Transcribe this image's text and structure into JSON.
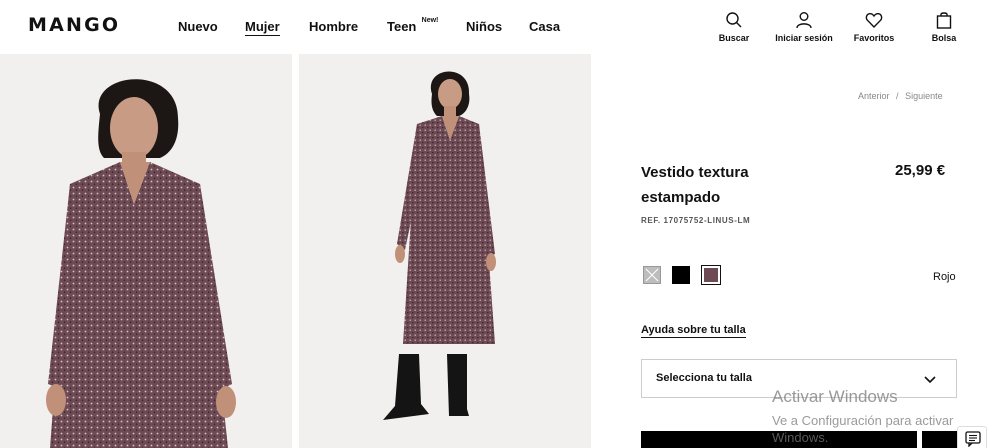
{
  "brand": {
    "logo": "MANGO"
  },
  "nav": {
    "items": [
      {
        "label": "Nuevo"
      },
      {
        "label": "Mujer",
        "active": true
      },
      {
        "label": "Hombre"
      },
      {
        "label": "Teen",
        "badge": "New!"
      },
      {
        "label": "Niños"
      },
      {
        "label": "Casa"
      }
    ]
  },
  "header_actions": {
    "search": "Buscar",
    "login": "Iniciar sesión",
    "favorites": "Favoritos",
    "bag": "Bolsa"
  },
  "pagination": {
    "previous": "Anterior",
    "separator": "/",
    "next": "Siguiente"
  },
  "product": {
    "title": "Vestido textura estampado",
    "price": "25,99 €",
    "reference": "REF. 17075752-LINUS-LM",
    "colors": [
      {
        "name": "gray-unavailable",
        "hex": "#bdbdbd"
      },
      {
        "name": "black",
        "hex": "#000000"
      },
      {
        "name": "red-selected",
        "hex": "#6e4b54",
        "selected": true
      }
    ],
    "selected_color": "Rojo",
    "size_help": "Ayuda sobre tu talla",
    "size_select_placeholder": "Selecciona tu talla"
  },
  "overlay": {
    "windows_title": "Activar Windows",
    "windows_subtitle_1": "Ve a Configuración para activar",
    "windows_subtitle_2": "Windows."
  },
  "colors": {
    "background": "#ffffff",
    "photo_background": "#f1f0ef",
    "text": "#111111",
    "dress": "#6e4b54"
  }
}
